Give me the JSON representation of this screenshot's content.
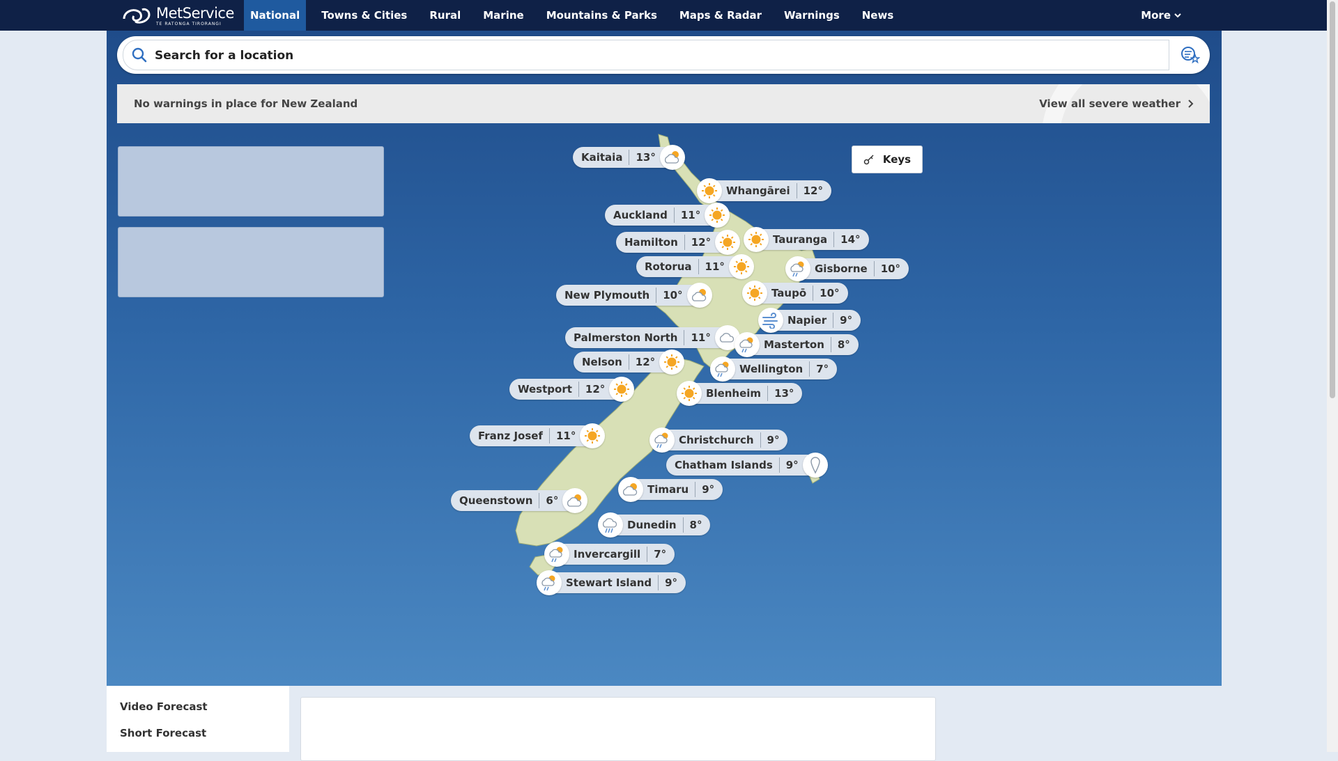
{
  "nav": {
    "logo_brand": "MetService",
    "logo_sub": "TE RATONGA TIRORANGI",
    "links": [
      "National",
      "Towns & Cities",
      "Rural",
      "Marine",
      "Mountains & Parks",
      "Maps & Radar",
      "Warnings",
      "News"
    ],
    "active": "National",
    "more_label": "More"
  },
  "search": {
    "placeholder": "Search for a location"
  },
  "warnings": {
    "message": "No warnings in place for New Zealand",
    "link_label": "View all severe weather"
  },
  "map": {
    "keys_label": "Keys",
    "cities": [
      {
        "name": "Kaitaia",
        "temp": "13°",
        "icon": "partly-cloudy-icon"
      },
      {
        "name": "Whangārei",
        "temp": "12°",
        "icon": "sunny-icon"
      },
      {
        "name": "Auckland",
        "temp": "11°",
        "icon": "sunny-icon"
      },
      {
        "name": "Hamilton",
        "temp": "12°",
        "icon": "sunny-icon"
      },
      {
        "name": "Tauranga",
        "temp": "14°",
        "icon": "sunny-icon"
      },
      {
        "name": "Rotorua",
        "temp": "11°",
        "icon": "sunny-icon"
      },
      {
        "name": "Gisborne",
        "temp": "10°",
        "icon": "showers-icon"
      },
      {
        "name": "New Plymouth",
        "temp": "10°",
        "icon": "partly-cloudy-icon"
      },
      {
        "name": "Taupō",
        "temp": "10°",
        "icon": "sunny-icon"
      },
      {
        "name": "Napier",
        "temp": "9°",
        "icon": "windy-icon"
      },
      {
        "name": "Palmerston North",
        "temp": "11°",
        "icon": "cloudy-icon"
      },
      {
        "name": "Masterton",
        "temp": "8°",
        "icon": "showers-icon"
      },
      {
        "name": "Nelson",
        "temp": "12°",
        "icon": "sunny-icon"
      },
      {
        "name": "Wellington",
        "temp": "7°",
        "icon": "showers-icon"
      },
      {
        "name": "Westport",
        "temp": "12°",
        "icon": "sunny-icon"
      },
      {
        "name": "Blenheim",
        "temp": "13°",
        "icon": "sunny-icon"
      },
      {
        "name": "Franz Josef",
        "temp": "11°",
        "icon": "sunny-icon"
      },
      {
        "name": "Christchurch",
        "temp": "9°",
        "icon": "showers-icon"
      },
      {
        "name": "Chatham Islands",
        "temp": "9°",
        "icon": "location-pin-icon"
      },
      {
        "name": "Timaru",
        "temp": "9°",
        "icon": "partly-cloudy-icon"
      },
      {
        "name": "Queenstown",
        "temp": "6°",
        "icon": "partly-cloudy-icon"
      },
      {
        "name": "Dunedin",
        "temp": "8°",
        "icon": "rain-icon"
      },
      {
        "name": "Invercargill",
        "temp": "7°",
        "icon": "showers-icon"
      },
      {
        "name": "Stewart Island",
        "temp": "9°",
        "icon": "showers-icon"
      }
    ]
  },
  "sidebar": {
    "items": [
      "Video Forecast",
      "Short Forecast"
    ]
  },
  "colors": {
    "nav_bg": "#0f2147",
    "nav_active": "#1f5a9f",
    "land": "#d8e0b6",
    "sun": "#f5a623"
  }
}
